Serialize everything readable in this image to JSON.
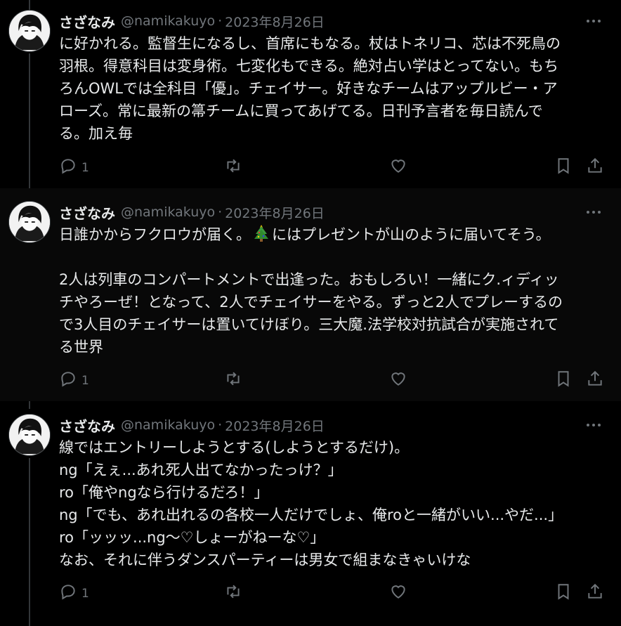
{
  "tweets": [
    {
      "author_name": "さざなみ",
      "handle": "@namikakuyo",
      "separator": "·",
      "date": "2023年8月26日",
      "lines": [
        "に好かれる。監督生になるし、首席にもなる。杖はトネリコ、芯は不死鳥の",
        "羽根。得意科目は変身術。七変化もできる。絶対占い学はとってない。もち",
        "ろんOWLでは全科目「優」。チェイサー。好きなチームはアップルビー・ア",
        "ローズ。常に最新の箒チームに買ってあげてる。日刊予言者を毎日読んで",
        "る。加え毎"
      ],
      "reply_count": "1",
      "avatar_icon": "anime-avatar-icon"
    },
    {
      "author_name": "さざなみ",
      "handle": "@namikakuyo",
      "separator": "·",
      "date": "2023年8月26日",
      "line1_before": "日誰かからフクロウが届く。",
      "line1_emoji": "christmas-tree-icon",
      "line1_after": "にはプレゼントが山のように届いてそう。",
      "lines": [
        "",
        "2人は列車のコンパートメントで出逢った。おもしろい！一緒にク.ィディッ",
        "チやろーぜ！となって、2人でチェイサーをやる。ずっと2人でプレーするの",
        "で3人目のチェイサーは置いてけぼり。三大魔.法学校対抗試合が実施されて",
        "る世界"
      ],
      "reply_count": "1",
      "avatar_icon": "anime-avatar-icon"
    },
    {
      "author_name": "さざなみ",
      "handle": "@namikakuyo",
      "separator": "·",
      "date": "2023年8月26日",
      "lines": [
        "線ではエントリーしようとする(しようとするだけ)。",
        "ng「えぇ...あれ死人出てなかったっけ？」",
        "ro「俺やngなら行けるだろ！」",
        "ng「でも、あれ出れるの各校一人だけでしょ、俺roと一緒がいい...やだ...」",
        "ro「ッッッ...ng〜♡しょーがねーな♡」",
        "なお、それに伴うダンスパーティーは男女で組まなきゃいけな"
      ],
      "reply_count": "1",
      "avatar_icon": "anime-avatar-icon"
    }
  ],
  "colors": {
    "background": "#000000",
    "highlight_background": "#080808",
    "text": "#e7e9ea",
    "muted": "#71767b",
    "thread_line": "#333639"
  }
}
